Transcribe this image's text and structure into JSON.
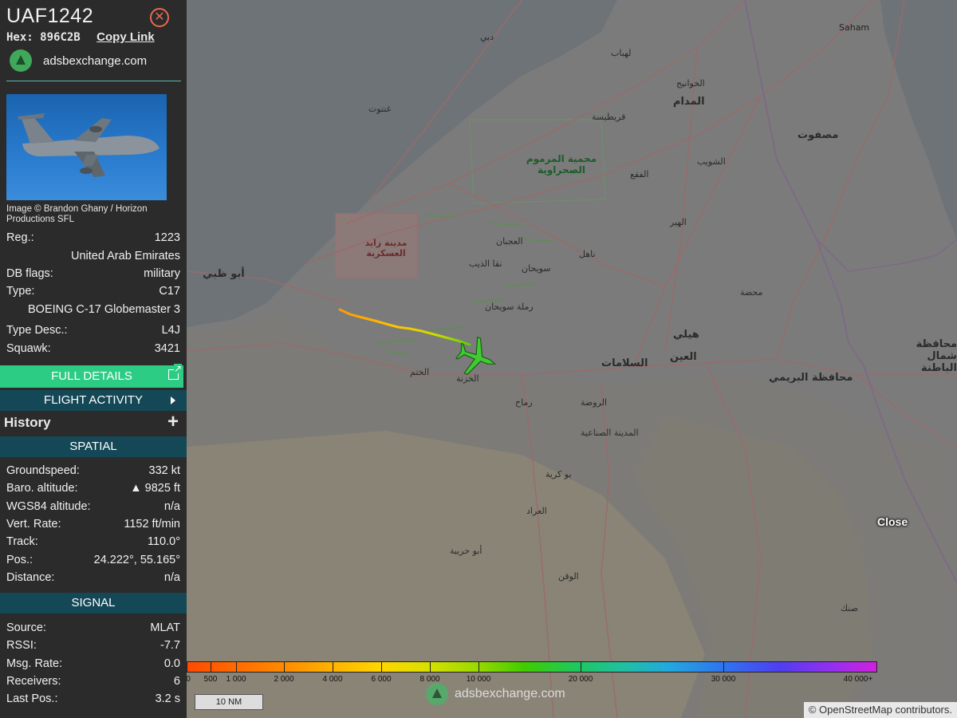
{
  "header": {
    "callsign": "UAF1242",
    "hex_label": "Hex:",
    "hex": "896C2B",
    "copy_link": "Copy Link",
    "brand": "adsbexchange.com"
  },
  "photo_credit": "Image © Brandon Ghany / Horizon Productions SFL",
  "aircraft": {
    "reg_label": "Reg.:",
    "reg": "1223",
    "country": "United Arab Emirates",
    "dbflags_label": "DB flags:",
    "dbflags": "military",
    "type_label": "Type:",
    "type": "C17",
    "model": "BOEING C-17 Globemaster 3",
    "typedesc_label": "Type Desc.:",
    "typedesc": "L4J",
    "squawk_label": "Squawk:",
    "squawk": "3421"
  },
  "buttons": {
    "full_details": "FULL DETAILS",
    "flight_activity": "FLIGHT ACTIVITY",
    "history": "History",
    "history_plus": "+"
  },
  "spatial": {
    "title": "SPATIAL",
    "rows": [
      {
        "k": "Groundspeed:",
        "v": "332 kt"
      },
      {
        "k": "Baro. altitude:",
        "v": "▲ 9825 ft"
      },
      {
        "k": "WGS84 altitude:",
        "v": "n/a"
      },
      {
        "k": "Vert. Rate:",
        "v": "1152 ft/min"
      },
      {
        "k": "Track:",
        "v": "110.0°"
      },
      {
        "k": "Pos.:",
        "v": "24.222°, 55.165°"
      },
      {
        "k": "Distance:",
        "v": "n/a"
      }
    ]
  },
  "signal": {
    "title": "SIGNAL",
    "rows": [
      {
        "k": "Source:",
        "v": "MLAT"
      },
      {
        "k": "RSSI:",
        "v": "-7.7"
      },
      {
        "k": "Msg. Rate:",
        "v": "0.0"
      },
      {
        "k": "Receivers:",
        "v": "6"
      },
      {
        "k": "Last Pos.:",
        "v": "3.2 s"
      }
    ]
  },
  "map": {
    "labels": {
      "abu_dhabi": "أبو ظبي",
      "zayed_city": "مدينة زايد العسكرية",
      "marmoum": "محمية المرموم الصحراوية",
      "ghantoot": "غنتوت",
      "al_ain": "العين",
      "salamat": "السلامات",
      "hili": "هيلي",
      "buraimi": "محافظة البريمي",
      "khatm": "الختم",
      "khazna": "الخزنة",
      "remah": "رماح",
      "rawdah": "الروضة",
      "sanaiya": "المدينة الصناعية",
      "abu_kriba": "بو كرية",
      "iraad": "العراد",
      "wagan": "الوقن",
      "abu_hurayba": "أبو حريبة",
      "swaihan": "رملة سويحان",
      "sweihan": "سويحان",
      "ajban": "العجبان",
      "naqa": "نقا الذيب",
      "nahel": "ناهل",
      "hair": "الهير",
      "faqa": "الفقع",
      "shuwaib": "الشويب",
      "madam": "المدام",
      "masfout": "مصفوت",
      "sinak": "صنك",
      "saham": "Saham",
      "mahda": "محضة",
      "qarytesa": "قريطيسة",
      "lahbab": "لهباب",
      "dubai": "دبي",
      "khawaneej": "الخوانيج",
      "north_batinah": "محافظة شمال الباطنة"
    },
    "close": "Close",
    "scale": "10 NM",
    "watermark": "adsbexchange.com",
    "attribution_symbol": "©",
    "attribution_link": "OpenStreetMap",
    "attribution_text": "contributors.",
    "altitude_legend": [
      "500",
      "1 000",
      "2 000",
      "4 000",
      "6 000",
      "8 000",
      "10 000",
      "20 000",
      "30 000",
      "40 000+"
    ],
    "altitude_legend_first": "0"
  }
}
